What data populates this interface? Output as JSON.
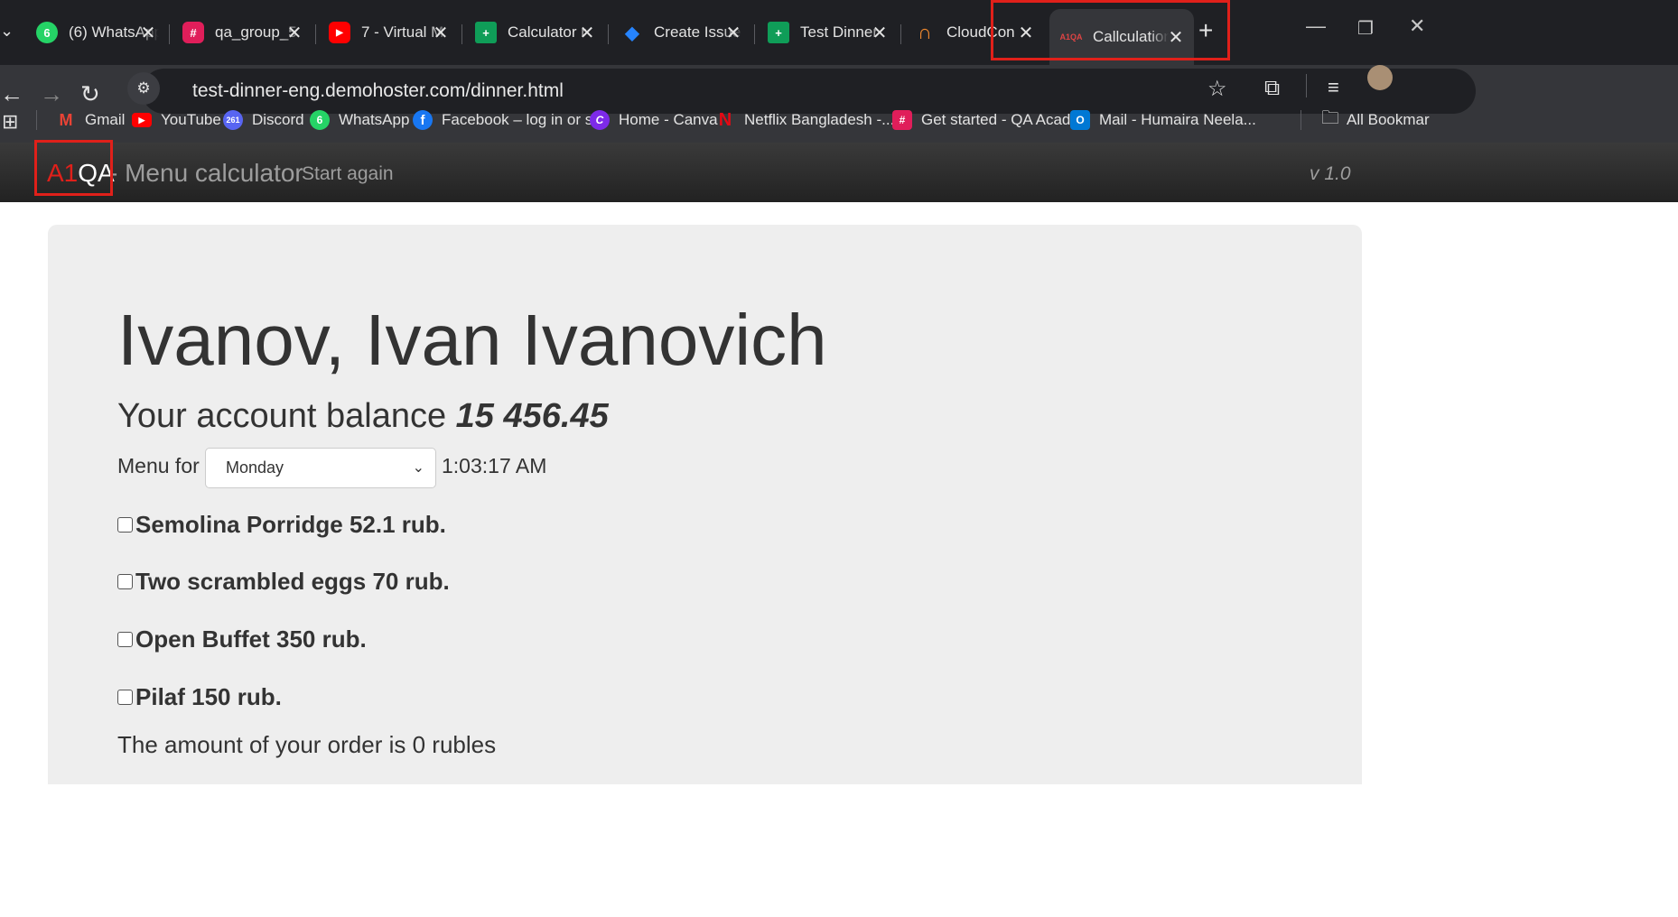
{
  "browser": {
    "tabs": [
      {
        "title": "(6) WhatsApp",
        "icon": "whatsapp-icon",
        "color": "#25d366",
        "glyph": "6"
      },
      {
        "title": "qa_group_5",
        "icon": "slack-icon",
        "color": "#e01e5a",
        "glyph": "#"
      },
      {
        "title": "7 - Virtual M",
        "icon": "youtube-icon",
        "color": "#ff0000",
        "glyph": "▶"
      },
      {
        "title": "Calculator r",
        "icon": "sheets-icon",
        "color": "#0f9d58",
        "glyph": "+"
      },
      {
        "title": "Create Issue",
        "icon": "jira-icon",
        "color": "#2684ff",
        "glyph": "◆"
      },
      {
        "title": "Test Dinner",
        "icon": "sheets-icon",
        "color": "#0f9d58",
        "glyph": "+"
      },
      {
        "title": "CloudCon",
        "icon": "cloudcon-icon",
        "color": "#f28a2e",
        "glyph": "∩"
      },
      {
        "title": "Callculation",
        "icon": "a1qa-icon",
        "color": "#35363a",
        "glyph": "A1QA"
      }
    ],
    "url": "test-dinner-eng.demohoster.com/dinner.html",
    "bookmarks": [
      {
        "label": "Gmail",
        "icon": "gmail-icon",
        "color": "#ea4335",
        "glyph": "M"
      },
      {
        "label": "YouTube",
        "icon": "youtube-icon",
        "color": "#ff0000",
        "glyph": "▶"
      },
      {
        "label": "Discord",
        "icon": "discord-icon",
        "color": "#5865f2",
        "glyph": "261"
      },
      {
        "label": "WhatsApp",
        "icon": "whatsapp-icon",
        "color": "#25d366",
        "glyph": "6"
      },
      {
        "label": "Facebook – log in or s...",
        "icon": "facebook-icon",
        "color": "#1877f2",
        "glyph": "f"
      },
      {
        "label": "Home - Canva",
        "icon": "canva-icon",
        "color": "#7d2ae8",
        "glyph": "C"
      },
      {
        "label": "Netflix Bangladesh -...",
        "icon": "netflix-icon",
        "color": "#e50914",
        "glyph": "N"
      },
      {
        "label": "Get started - QA Acad...",
        "icon": "slack-icon",
        "color": "#e01e5a",
        "glyph": "#"
      },
      {
        "label": "Mail - Humaira Neela...",
        "icon": "outlook-icon",
        "color": "#0078d4",
        "glyph": "O"
      }
    ],
    "all_bookmarks": "All Bookmar"
  },
  "app": {
    "brand_a1": "A1",
    "brand_qa": "QA",
    "brand_sub": "- Menu calculator",
    "start_again": "Start again",
    "version": "v 1.0"
  },
  "page": {
    "name": "Ivanov, Ivan Ivanovich",
    "balance_label": "Your account balance",
    "balance_value": "15 456.45",
    "menu_for": "Menu for",
    "day": "Monday",
    "time": "1:03:17 AM",
    "items": [
      {
        "label": "Semolina Porridge 52.1 rub.",
        "checked": false
      },
      {
        "label": "Two scrambled eggs 70 rub.",
        "checked": false
      },
      {
        "label": "Open Buffet 350 rub.",
        "checked": false
      },
      {
        "label": "Pilaf 150 rub.",
        "checked": false
      }
    ],
    "total": "The amount of your order is 0 rubles"
  },
  "colors": {
    "highlight": "#e0201a",
    "brand_red": "#e0201a",
    "panel_bg": "#eeeeee",
    "appbar_bg": "#222222"
  }
}
